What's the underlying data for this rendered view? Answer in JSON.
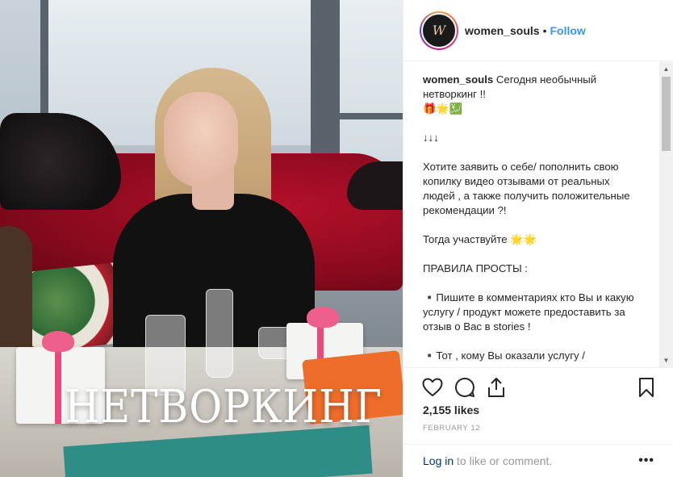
{
  "post": {
    "overlay_text": "НЕТВОРКИНГ"
  },
  "header": {
    "avatar_monogram": "W",
    "username": "women_souls",
    "separator": "•",
    "follow_label": "Follow"
  },
  "caption": {
    "username": "women_souls",
    "lines": [
      "Сегодня необычный нетворкинг !!",
      "🎁🌟💹",
      "",
      "↓↓↓",
      "",
      "Хотите заявить о себе/ пополнить свою копилку видео отзывами от реальных людей , а также получить положительные рекомендации ?!",
      "",
      "Тогда участвуйте 🌟🌟",
      "",
      "ПРАВИЛА ПРОСТЫ :",
      "",
      "▪️Пишите в комментариях кто Вы и какую услугу / продукт можете предоставить за отзыв о Вас в stories !",
      "",
      "▪️Тот , кому Вы оказали услугу /"
    ]
  },
  "actions": {
    "like_icon": "heart-icon",
    "comment_icon": "comment-icon",
    "share_icon": "share-icon",
    "save_icon": "bookmark-icon"
  },
  "stats": {
    "likes": "2,155 likes",
    "date": "FEBRUARY 12"
  },
  "footer": {
    "login_label": "Log in",
    "login_suffix": " to like or comment.",
    "more_label": "•••"
  },
  "colors": {
    "accent": "#3897f0",
    "login_link": "#003569",
    "muted": "#999999"
  }
}
